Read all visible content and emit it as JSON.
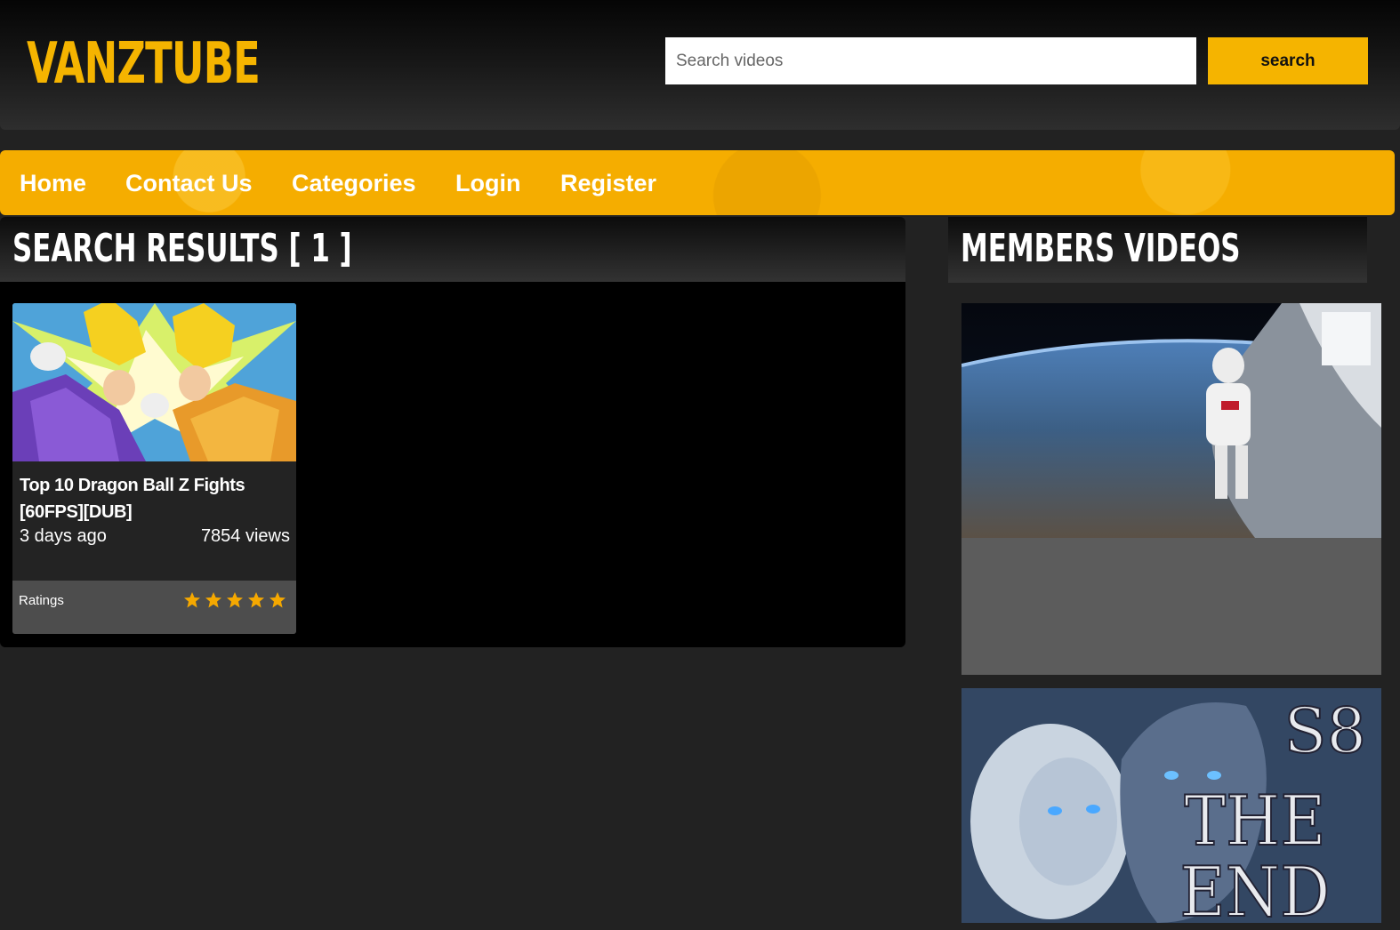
{
  "header": {
    "logo": "VANZTUBE",
    "search_placeholder": "Search videos",
    "search_button": "search"
  },
  "nav": {
    "items": [
      "Home",
      "Contact Us",
      "Categories",
      "Login",
      "Register"
    ]
  },
  "results": {
    "title": "SEARCH RESULTS [ 1 ]",
    "videos": [
      {
        "title": "Top 10 Dragon Ball Z Fights [60FPS][DUB]",
        "age": "3 days ago",
        "views": "7854 views",
        "ratings_label": "Ratings",
        "stars": 5,
        "thumbnail_icon": "anime-fight-thumbnail"
      }
    ]
  },
  "sidebar": {
    "title": "MEMBERS VIDEOS",
    "videos": [
      {
        "thumbnail_icon": "space-jump-thumbnail"
      },
      {
        "thumbnail_icon": "s8-the-end-thumbnail",
        "thumbnail_text": [
          "S8",
          "THE",
          "END"
        ]
      }
    ]
  },
  "colors": {
    "accent": "#f5b400",
    "background": "#222222",
    "panel": "#000000"
  }
}
